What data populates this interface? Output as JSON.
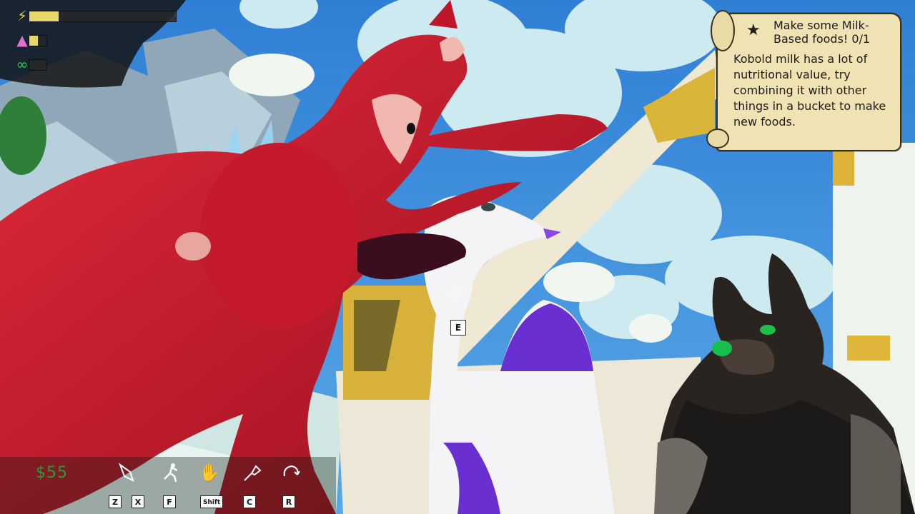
{
  "hud": {
    "stats": [
      {
        "icon": "lightning-icon",
        "glyph": "⚡",
        "color": "#e8c93a",
        "level": 0.2
      },
      {
        "icon": "pink-kobold-icon",
        "glyph": "▲",
        "color": "#e06fcf",
        "level": 0.5
      },
      {
        "icon": "dna-icon",
        "glyph": "∞",
        "color": "#2bd24a",
        "level": 0.0
      }
    ]
  },
  "quest": {
    "title": "Make some Milk-Based foods! 0/1",
    "description": "Kobold milk has a lot of nutritional value, try combining it with other things in a bucket to make new foods."
  },
  "toolbar": {
    "money": "$55",
    "keys": [
      "Z",
      "X",
      "F",
      "Shift",
      "C",
      "R"
    ]
  },
  "interaction": {
    "prompt_key": "E",
    "heart_glyph": "♡"
  }
}
